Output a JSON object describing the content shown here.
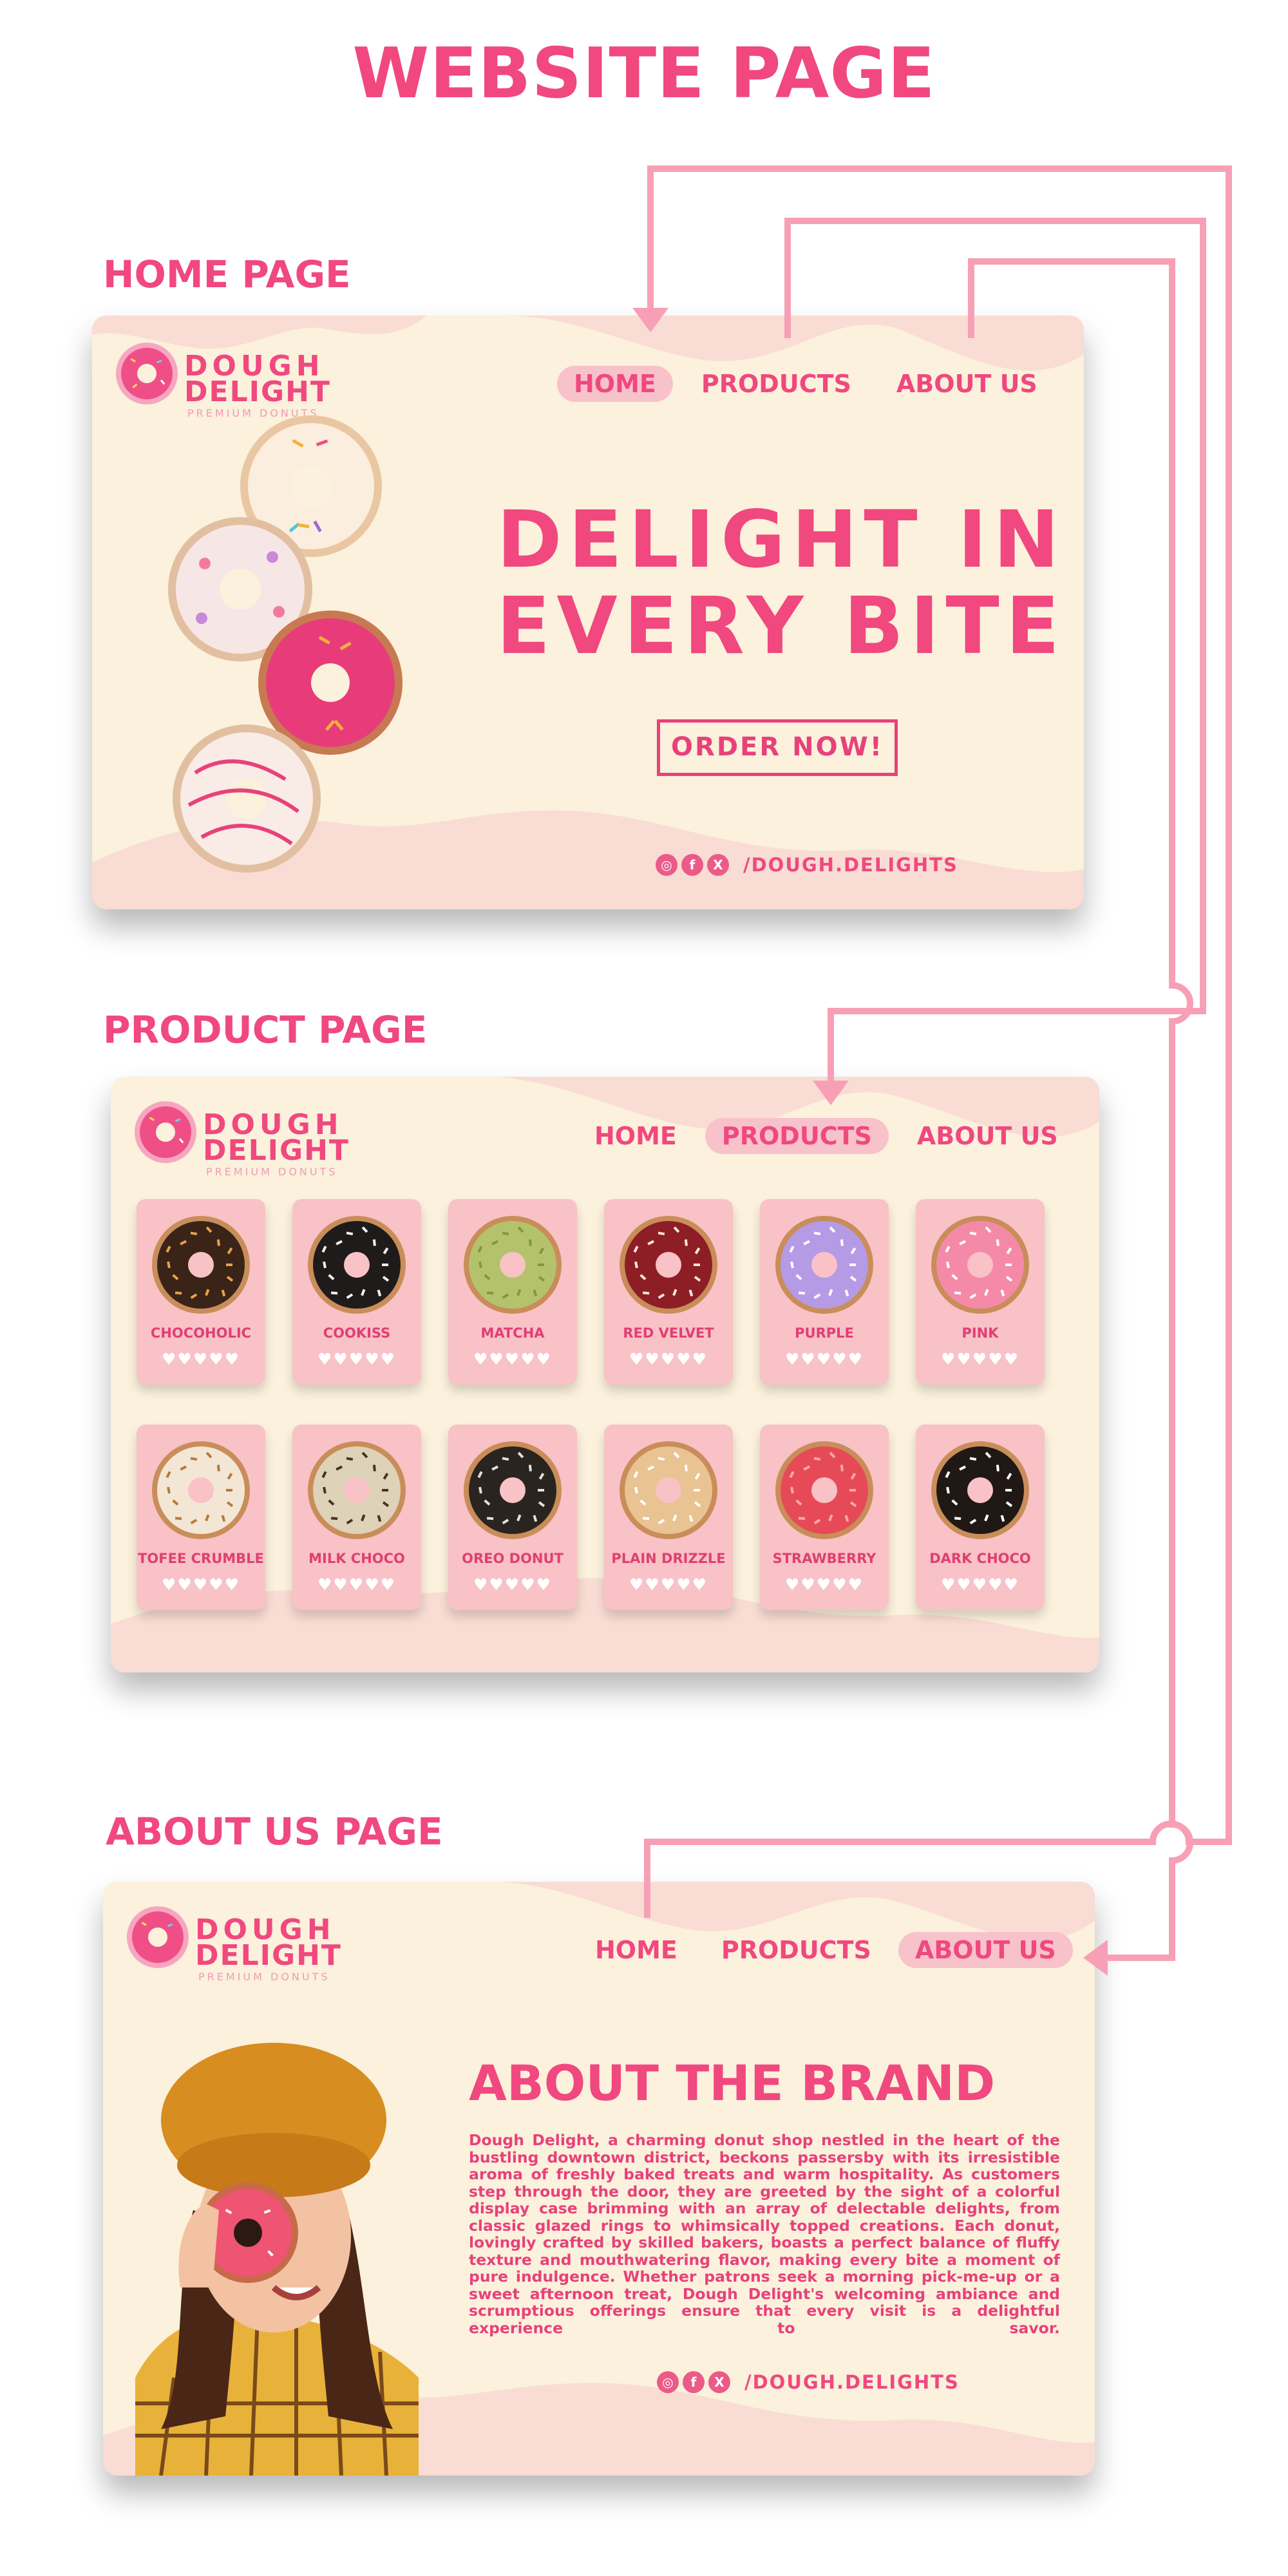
{
  "page_title": "WEBSITE PAGE",
  "brand": {
    "line1": "DOUGH",
    "line2": "DELIGHT",
    "tagline": "PREMIUM DONUTS"
  },
  "nav": {
    "home": "HOME",
    "products": "PRODUCTS",
    "about": "ABOUT US"
  },
  "social_handle": "/DOUGH.DELIGHTS",
  "home": {
    "label": "HOME PAGE",
    "active_nav": "HOME",
    "headline_line1": "DELIGHT IN",
    "headline_line2": "EVERY BITE",
    "cta": "ORDER NOW!"
  },
  "products": {
    "label": "PRODUCT PAGE",
    "active_nav": "PRODUCTS",
    "items": [
      {
        "name": "CHOCOHOLIC",
        "color": "#3a2418",
        "topping": "#e9a24a"
      },
      {
        "name": "COOKISS",
        "color": "#1f1b1a",
        "topping": "#f2f2f2"
      },
      {
        "name": "MATCHA",
        "color": "#b4c36b",
        "topping": "#7e9a3a"
      },
      {
        "name": "RED VELVET",
        "color": "#8e1e25",
        "topping": "#f5e6e0"
      },
      {
        "name": "PURPLE",
        "color": "#b59ae6",
        "topping": "#ffffff"
      },
      {
        "name": "PINK",
        "color": "#f58aa8",
        "topping": "#ffffff"
      },
      {
        "name": "TOFEE CRUMBLE",
        "color": "#f3e6d5",
        "topping": "#b87a3a"
      },
      {
        "name": "MILK CHOCO",
        "color": "#ded2b8",
        "topping": "#4a3222"
      },
      {
        "name": "OREO DONUT",
        "color": "#2a2420",
        "topping": "#e8e0d6"
      },
      {
        "name": "PLAIN DRIZZLE",
        "color": "#e9c392",
        "topping": "#ffffff"
      },
      {
        "name": "STRAWBERRY",
        "color": "#e74a57",
        "topping": "#f7a8a8"
      },
      {
        "name": "DARK CHOCO",
        "color": "#1f1814",
        "topping": "#ffffff"
      }
    ],
    "rating": "♥♥♥♥♥"
  },
  "about": {
    "label": "ABOUT US PAGE",
    "active_nav": "ABOUT US",
    "title": "ABOUT THE BRAND",
    "body": "Dough Delight, a charming donut shop nestled in the heart of the bustling downtown district, beckons passersby with its irresistible aroma of freshly baked treats and warm hospitality. As customers step through the door, they are greeted by the sight of a colorful display case brimming with an array of delectable delights, from classic glazed rings to whimsically topped creations. Each donut, lovingly crafted by skilled bakers, boasts a perfect balance of fluffy texture and mouthwatering flavor, making every bite a moment of pure indulgence. Whether patrons seek a morning pick-me-up or a sweet afternoon treat, Dough Delight's welcoming ambiance and scrumptious offerings ensure that every visit is a delightful experience to savor."
  },
  "colors": {
    "accent": "#f0487f",
    "cream": "#fbf1dc",
    "pink_soft": "#f8c2ca",
    "connector": "#f7a0b5"
  }
}
